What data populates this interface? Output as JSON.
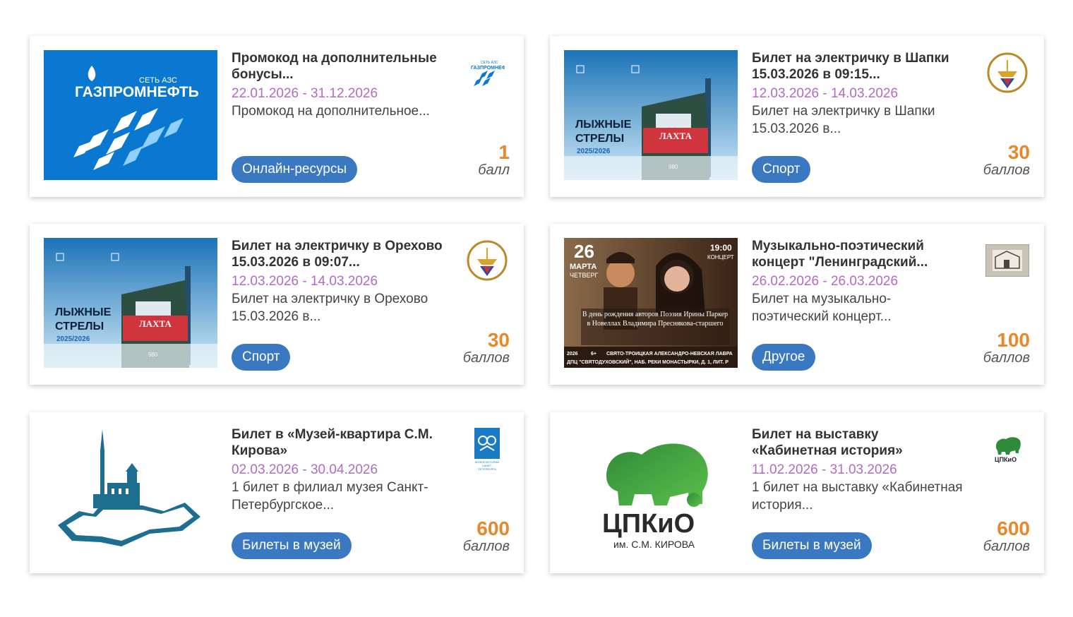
{
  "cards": [
    {
      "title": "Промокод на дополнительные бонусы...",
      "dates": "22.01.2026 - 31.12.2026",
      "description": "Промокод на дополнительное...",
      "category": "Онлайн-ресурсы",
      "points": "1",
      "points_word": "балл",
      "thumb": {
        "brand_small": "СЕТЬ АЗС",
        "brand": "ГАЗПРОМНЕФТЬ"
      },
      "logo_icon": "gazpromneft-logo"
    },
    {
      "title": "Билет на электричку в Шапки 15.03.2026 в 09:15...",
      "dates": "12.03.2026 - 14.03.2026",
      "description": "Билет на электричку в Шапки 15.03.2026 в...",
      "category": "Спорт",
      "points": "30",
      "points_word": "баллов",
      "thumb": {
        "line1": "ЛЫЖНЫЕ",
        "line2": "СТРЕЛЫ",
        "season": "2025/2026",
        "train": "ЛАХТА",
        "number": "980"
      },
      "logo_icon": "ship-emblem-logo"
    },
    {
      "title": "Билет на электричку в Орехово 15.03.2026 в 09:07...",
      "dates": "12.03.2026 - 14.03.2026",
      "description": "Билет на электричку в Орехово 15.03.2026 в...",
      "category": "Спорт",
      "points": "30",
      "points_word": "баллов",
      "thumb": {
        "line1": "ЛЫЖНЫЕ",
        "line2": "СТРЕЛЫ",
        "season": "2025/2026",
        "train": "ЛАХТА",
        "number": "980"
      },
      "logo_icon": "ship-emblem-logo"
    },
    {
      "title": "Музыкально-поэтический концерт \"Ленинградский...",
      "dates": "26.02.2026 - 26.03.2026",
      "description": "Билет на музыкально-поэтический концерт...",
      "category": "Другое",
      "points": "100",
      "points_word": "баллов",
      "thumb": {
        "day": "26",
        "month": "МАРТА",
        "weekday": "ЧЕТВЕРГ",
        "time": "19:00",
        "kind": "КОНЦЕРТ",
        "caption": "В день рождения авторов Поэзия Ирины Паркер в Новеллах Владимира Преснякова-старшего",
        "venue": "СВЯТО-ТРОИЦКАЯ АЛЕКСАНДРО-НЕВСКАЯ ЛАВРА",
        "address": "ДПЦ \"СВЯТОДУХОВСКИЙ\", НАБ. РЕКИ МОНАСТЫРКИ, Д. 1, ЛИТ. Р",
        "year": "2026",
        "age": "6+"
      },
      "logo_icon": "building-sketch-logo"
    },
    {
      "title": "Билет в «Музей-квартира С.М. Кирова»",
      "dates": "02.03.2026 - 30.04.2026",
      "description": "1 билет в филиал музея Санкт-Петербургское...",
      "category": "Билеты в музей",
      "points": "600",
      "points_word": "баллов",
      "thumb": {},
      "logo_icon": "museum-history-logo",
      "logo_text": "МУЗЕЙ ИСТОРИИ САНКТ-ПЕТЕРБУРГА"
    },
    {
      "title": "Билет на выставку «Кабинетная история»",
      "dates": "11.02.2026 - 31.03.2026",
      "description": "1 билет на выставку «Кабинетная история...",
      "category": "Билеты в музей",
      "points": "600",
      "points_word": "баллов",
      "thumb": {
        "name": "ЦПКиО",
        "sub": "им. С.М. КИРОВА"
      },
      "logo_icon": "cpkio-lion-logo",
      "logo_text": "ЦПКиО"
    }
  ],
  "colors": {
    "accent": "#3a79c2",
    "dates": "#b36ac3",
    "points": "#e9882a",
    "gazprom_blue": "#0a78d0",
    "cpkio_green": "#3da543"
  }
}
